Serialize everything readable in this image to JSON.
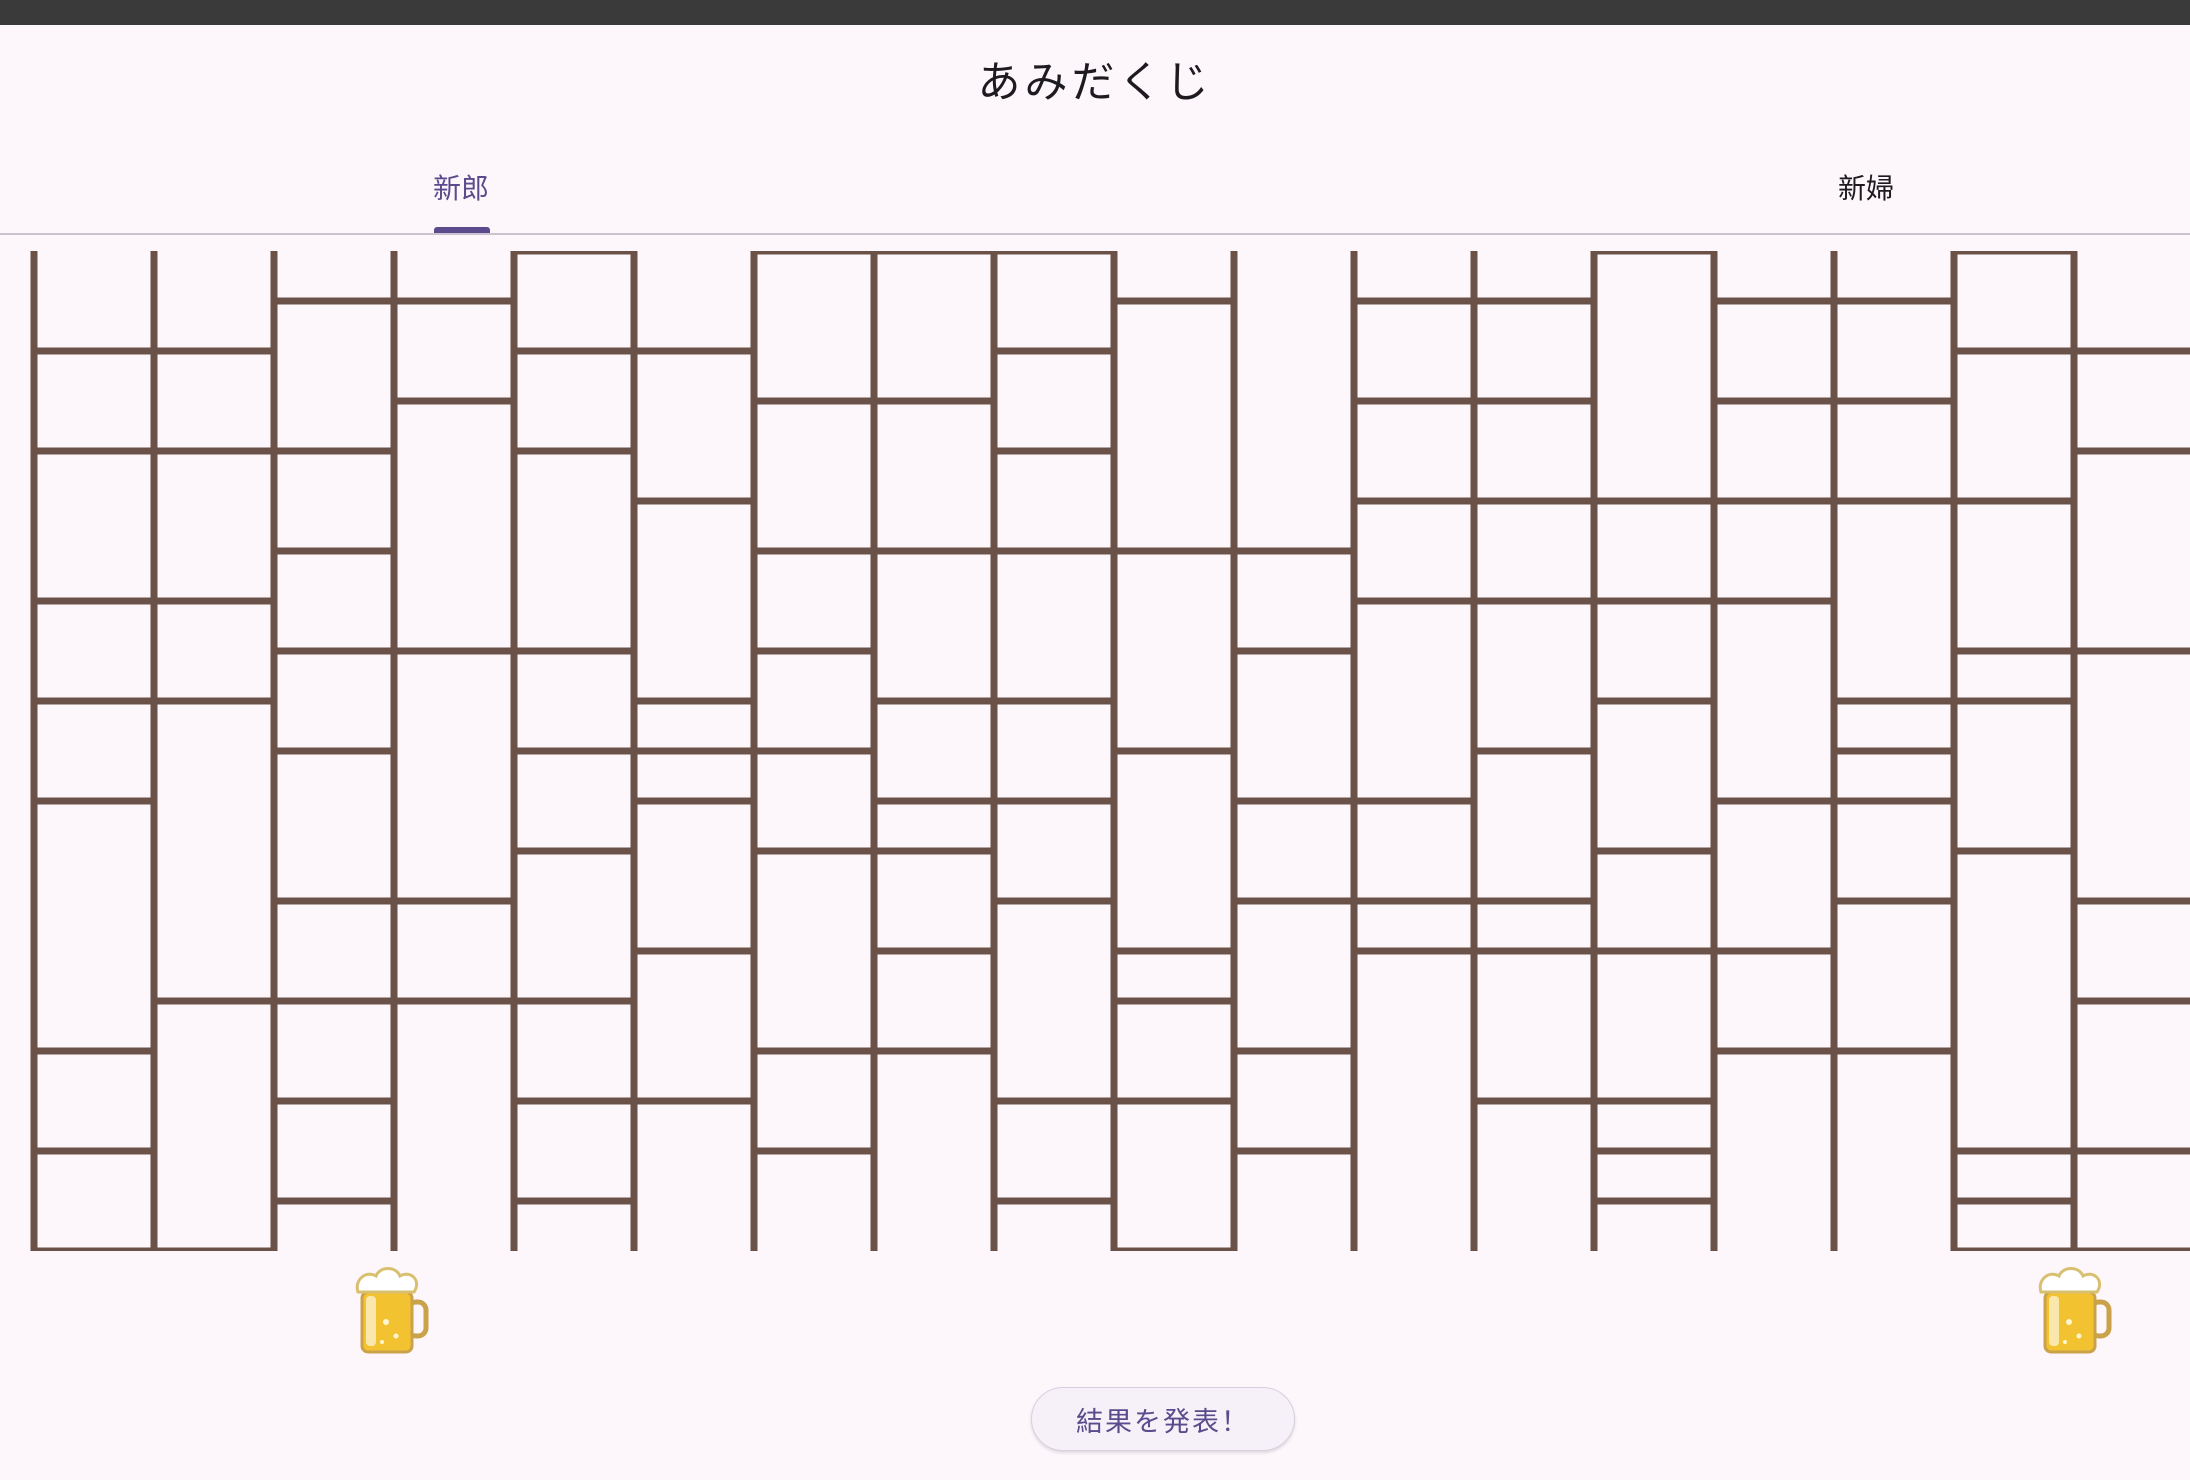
{
  "app": {
    "title": "あみだくじ"
  },
  "tabs": [
    {
      "label": "新郎",
      "selected": true
    },
    {
      "label": "新婦",
      "selected": false
    }
  ],
  "ladder": {
    "line_color": "#6b5248",
    "rows": 20,
    "rungs": [
      [
        -1,
        5
      ],
      [
        -1,
        7
      ],
      [
        -1,
        8
      ],
      [
        -1,
        9
      ],
      [
        -1,
        14
      ],
      [
        -1,
        17
      ],
      [
        -1,
        19
      ],
      [
        0,
        3
      ],
      [
        0,
        4
      ],
      [
        0,
        10
      ],
      [
        0,
        12
      ],
      [
        0,
        13
      ],
      [
        0,
        15
      ],
      [
        0,
        16
      ],
      [
        1,
        1
      ],
      [
        1,
        2
      ],
      [
        1,
        5
      ],
      [
        1,
        6
      ],
      [
        1,
        9
      ],
      [
        1,
        17
      ],
      [
        1,
        18
      ],
      [
        2,
        4
      ],
      [
        2,
        7
      ],
      [
        2,
        8
      ],
      [
        2,
        12
      ],
      [
        2,
        13
      ],
      [
        2,
        15
      ],
      [
        2,
        16
      ],
      [
        3,
        1
      ],
      [
        3,
        2
      ],
      [
        3,
        3
      ],
      [
        3,
        5
      ],
      [
        3,
        9
      ],
      [
        3,
        18
      ],
      [
        3,
        19
      ],
      [
        4,
        6
      ],
      [
        4,
        12
      ],
      [
        4,
        13
      ],
      [
        4,
        14
      ],
      [
        4,
        15
      ],
      [
        4,
        16
      ],
      [
        4,
        17
      ],
      [
        5,
        3
      ],
      [
        5,
        7
      ],
      [
        5,
        8
      ],
      [
        5,
        9
      ],
      [
        5,
        10
      ],
      [
        5,
        11
      ],
      [
        5,
        19
      ],
      [
        6,
        1
      ],
      [
        6,
        2
      ],
      [
        6,
        12
      ],
      [
        6,
        13
      ],
      [
        6,
        14
      ],
      [
        6,
        15
      ],
      [
        7,
        3
      ],
      [
        7,
        4
      ],
      [
        7,
        5
      ],
      [
        7,
        7
      ],
      [
        7,
        11
      ],
      [
        7,
        17
      ],
      [
        7,
        18
      ],
      [
        8,
        1
      ],
      [
        8,
        2
      ],
      [
        8,
        6
      ],
      [
        8,
        8
      ],
      [
        8,
        9
      ],
      [
        8,
        14
      ],
      [
        8,
        16
      ],
      [
        8,
        17
      ],
      [
        9,
        3
      ],
      [
        9,
        5
      ],
      [
        9,
        6
      ],
      [
        9,
        7
      ],
      [
        9,
        10
      ],
      [
        9,
        13
      ],
      [
        9,
        16
      ],
      [
        10,
        1
      ],
      [
        10,
        6
      ],
      [
        10,
        8
      ],
      [
        10,
        9
      ],
      [
        10,
        11
      ],
      [
        10,
        12
      ],
      [
        10,
        15
      ],
      [
        10,
        16
      ],
      [
        11,
        5
      ],
      [
        11,
        7
      ],
      [
        11,
        8
      ],
      [
        11,
        14
      ],
      [
        11,
        17
      ],
      [
        11,
        19
      ],
      [
        12,
        3
      ],
      [
        12,
        4
      ],
      [
        12,
        9
      ],
      [
        12,
        11
      ],
      [
        12,
        12
      ],
      [
        12,
        13
      ],
      [
        12,
        16
      ],
      [
        12,
        18
      ],
      [
        13,
        6
      ],
      [
        13,
        8
      ],
      [
        13,
        10
      ],
      [
        13,
        12
      ],
      [
        13,
        13
      ],
      [
        13,
        14
      ],
      [
        13,
        15
      ],
      [
        14,
        2
      ],
      [
        14,
        3
      ],
      [
        14,
        4
      ],
      [
        14,
        5
      ],
      [
        14,
        10
      ],
      [
        14,
        18
      ],
      [
        14,
        19
      ],
      [
        15,
        1
      ],
      [
        15,
        7
      ],
      [
        15,
        8
      ],
      [
        15,
        11
      ],
      [
        15,
        15
      ],
      [
        15,
        16
      ],
      [
        16,
        3
      ],
      [
        16,
        5
      ],
      [
        16,
        6
      ],
      [
        16,
        9
      ],
      [
        16,
        10
      ],
      [
        16,
        13
      ],
      [
        16,
        14
      ],
      [
        17,
        1
      ],
      [
        17,
        7
      ],
      [
        17,
        11
      ],
      [
        17,
        14
      ],
      [
        17,
        17
      ],
      [
        17,
        18
      ],
      [
        18,
        3
      ],
      [
        18,
        5
      ],
      [
        18,
        9
      ],
      [
        18,
        14
      ],
      [
        18,
        17
      ],
      [
        19,
        1
      ],
      [
        19,
        2
      ],
      [
        19,
        10
      ],
      [
        19,
        17
      ],
      [
        19,
        18
      ]
    ]
  },
  "goals": [
    {
      "icon": "beer-mug-icon"
    },
    {
      "icon": "beer-mug-icon"
    }
  ],
  "result_button": {
    "label": "結果を発表！"
  }
}
